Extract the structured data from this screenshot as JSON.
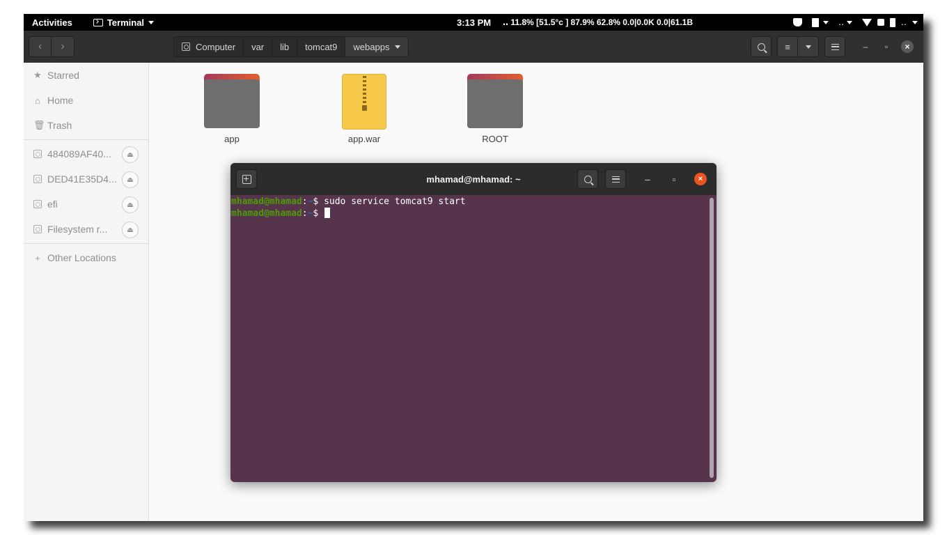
{
  "topbar": {
    "activities": "Activities",
    "app_name": "Terminal",
    "clock": "3:13 PM",
    "system_stats": "‥ 11.8% [51.5°c ] 87.9% 62.8%   0.0|0.0K  0.0|61.1B",
    "tray_dropdown": "‥"
  },
  "header": {
    "breadcrumb": [
      {
        "label": "Computer"
      },
      {
        "label": "var"
      },
      {
        "label": "lib"
      },
      {
        "label": "tomcat9"
      },
      {
        "label": "webapps"
      }
    ]
  },
  "sidebar": {
    "items": [
      {
        "label": "Starred",
        "icon": "star-icon"
      },
      {
        "label": "Home",
        "icon": "home-icon"
      },
      {
        "label": "Trash",
        "icon": "trash-icon"
      }
    ],
    "drives": [
      {
        "label": "484089AF40..."
      },
      {
        "label": "DED41E35D4..."
      },
      {
        "label": "efi"
      },
      {
        "label": "Filesystem r..."
      }
    ],
    "other_locations": "Other Locations"
  },
  "files": [
    {
      "name": "app",
      "type": "folder"
    },
    {
      "name": "app.war",
      "type": "archive"
    },
    {
      "name": "ROOT",
      "type": "folder"
    }
  ],
  "terminal": {
    "title": "mhamad@mhamad: ~",
    "prompt_user": "mhamad@mhamad",
    "prompt_sep": ":",
    "prompt_path": "~",
    "prompt_dollar": "$ ",
    "lines": [
      {
        "command": "sudo service tomcat9 start"
      },
      {
        "command": ""
      }
    ]
  },
  "colors": {
    "terminal_bg": "#55344c",
    "header_bg": "#303030",
    "accent_close": "#e95420",
    "prompt_user": "#4e9a06",
    "prompt_path": "#3465a4"
  }
}
